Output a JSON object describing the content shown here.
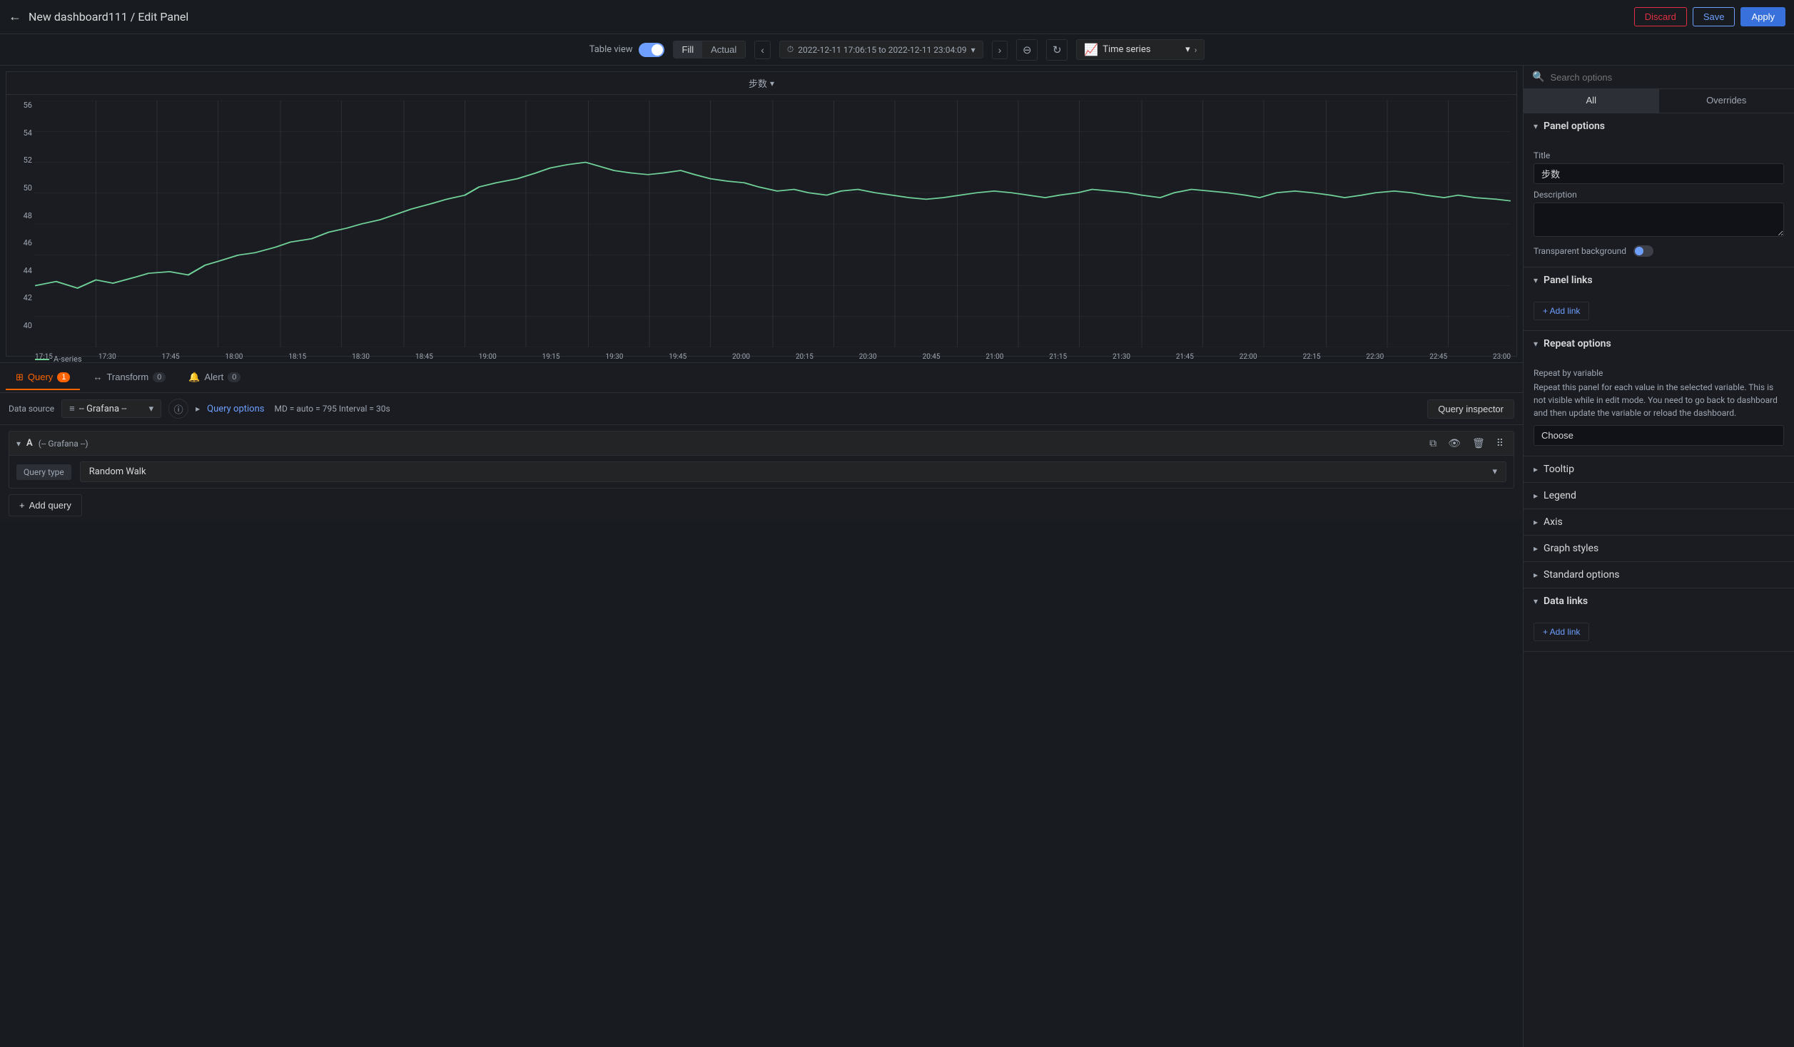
{
  "topbar": {
    "back_icon": "←",
    "title": "New dashboard111 / Edit Panel",
    "discard_label": "Discard",
    "save_label": "Save",
    "apply_label": "Apply"
  },
  "toolbar": {
    "table_view_label": "Table view",
    "fill_label": "Fill",
    "actual_label": "Actual",
    "time_range": "2022-12-11 17:06:15 to 2022-12-11 23:04:09",
    "vis_icon": "📈",
    "vis_label": "Time series"
  },
  "chart": {
    "title": "步数",
    "title_arrow": "⌄",
    "y_axis": [
      "56",
      "54",
      "52",
      "50",
      "48",
      "46",
      "44",
      "42",
      "40"
    ],
    "x_axis": [
      "17:15",
      "17:30",
      "17:45",
      "18:00",
      "18:15",
      "18:30",
      "18:45",
      "19:00",
      "19:15",
      "19:30",
      "19:45",
      "20:00",
      "20:15",
      "20:30",
      "20:45",
      "21:00",
      "21:15",
      "21:30",
      "21:45",
      "22:00",
      "22:15",
      "22:30",
      "22:45",
      "23:00"
    ],
    "legend_label": "A-series"
  },
  "query_tabs": [
    {
      "label": "Query",
      "count": "1",
      "icon": "⊞"
    },
    {
      "label": "Transform",
      "count": "0",
      "icon": "↔"
    },
    {
      "label": "Alert",
      "count": "0",
      "icon": "🔔"
    }
  ],
  "ds_bar": {
    "label": "Data source",
    "ds_name": "-- Grafana --",
    "query_options_label": "Query options",
    "query_meta": "MD = auto = 795   Interval = 30s",
    "inspector_label": "Query inspector"
  },
  "query_row": {
    "letter": "A",
    "ds_name": "(-- Grafana --)",
    "query_type_label": "Query type",
    "query_type_value": "Random Walk"
  },
  "add_query_btn": "+ Add query",
  "right_panel": {
    "search_placeholder": "Search options",
    "tabs": [
      "All",
      "Overrides"
    ],
    "panel_options": {
      "title_label": "Panel options",
      "title_field_label": "Title",
      "title_value": "步数",
      "desc_label": "Description",
      "desc_value": "",
      "transparent_label": "Transparent background"
    },
    "panel_links": {
      "title": "Panel links",
      "add_label": "+ Add link"
    },
    "repeat_options": {
      "title": "Repeat options",
      "repeat_by_label": "Repeat by variable",
      "description": "Repeat this panel for each value in the selected variable. This is not visible while in edit mode. You need to go back to dashboard and then update the variable or reload the dashboard.",
      "choose_label": "Choose"
    },
    "collapsed_sections": [
      "Tooltip",
      "Legend",
      "Axis",
      "Graph styles",
      "Standard options"
    ],
    "data_links": {
      "title": "Data links",
      "add_label": "+ Add link"
    }
  }
}
